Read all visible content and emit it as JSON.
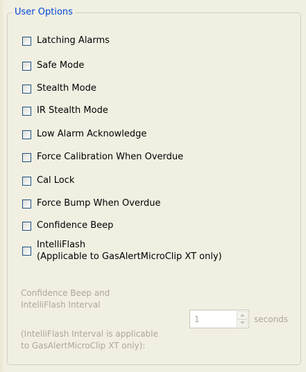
{
  "group": {
    "title": "User Options"
  },
  "options": [
    {
      "label": "Latching Alarms",
      "checked": false
    },
    {
      "label": "Safe Mode",
      "checked": false
    },
    {
      "label": "Stealth Mode",
      "checked": false
    },
    {
      "label": "IR Stealth Mode",
      "checked": false
    },
    {
      "label": "Low Alarm Acknowledge",
      "checked": false
    },
    {
      "label": "Force Calibration When Overdue",
      "checked": false
    },
    {
      "label": "Cal Lock",
      "checked": false
    },
    {
      "label": "Force Bump When Overdue",
      "checked": false
    },
    {
      "label": "Confidence Beep",
      "checked": false
    }
  ],
  "intelliflash": {
    "line1": "IntelliFlash",
    "line2": "(Applicable to GasAlertMicroClip XT only)",
    "checked": false
  },
  "interval": {
    "label_line1": "Confidence Beep and",
    "label_line2": "IntelliFlash Interval",
    "note_line1": "(IntelliFlash Interval is applicable",
    "note_line2": "to GasAlertMicroClip XT only):",
    "value": "1",
    "unit": "seconds",
    "enabled": false
  },
  "colors": {
    "title": "#0046d5",
    "disabled_text": "#aca899",
    "panel_bg": "#f1efe2",
    "checkbox_border": "#1c5180"
  },
  "icons": {
    "spin_up": "up-arrow-icon",
    "spin_down": "down-arrow-icon"
  }
}
